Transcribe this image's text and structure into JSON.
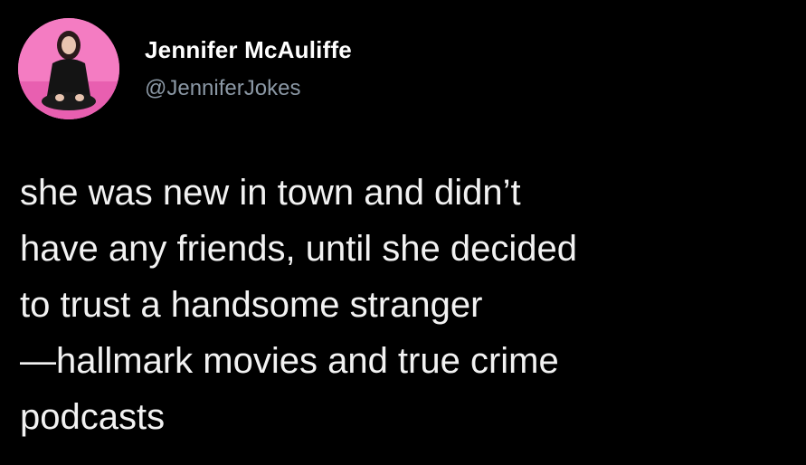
{
  "tweet": {
    "author": {
      "display_name": "Jennifer McAuliffe",
      "handle": "@JenniferJokes",
      "avatar_icon": "profile-photo"
    },
    "text_lines": [
      "she was new in town and didn’t",
      "have any friends, until she decided",
      "to trust a handsome stranger",
      "—hallmark movies and true crime",
      "podcasts"
    ]
  },
  "colors": {
    "background": "#000000",
    "name": "#ffffff",
    "handle": "#8b98a5",
    "text": "#f2f2f2",
    "avatar_bg": "#f06cb8"
  }
}
